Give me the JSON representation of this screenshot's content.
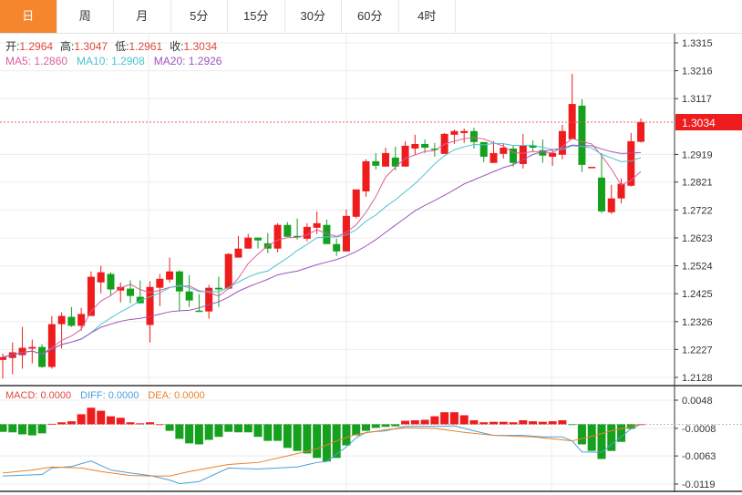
{
  "tabs": [
    {
      "label": "日",
      "active": true
    },
    {
      "label": "周"
    },
    {
      "label": "月"
    },
    {
      "label": "5分"
    },
    {
      "label": "15分"
    },
    {
      "label": "30分"
    },
    {
      "label": "60分"
    },
    {
      "label": "4时"
    }
  ],
  "info": {
    "open_label": "开:",
    "open": "1.2964",
    "high_label": "高:",
    "high": "1.3047",
    "low_label": "低:",
    "low": "1.2961",
    "close_label": "收:",
    "close": "1.3034",
    "ma5": "MA5: 1.2860",
    "ma10": "MA10: 1.2908",
    "ma20": "MA20: 1.2926"
  },
  "macd_info": {
    "macd": "MACD: 0.0000",
    "diff": "DIFF: 0.0000",
    "dea": "DEA: 0.0000"
  },
  "current_price": "1.3034",
  "colors": {
    "up": "#ee1c1c",
    "down": "#15a01e",
    "ma5": "#d9609a",
    "ma10": "#4cc3d0",
    "ma20": "#9b55bb",
    "diff": "#4b9fd8",
    "dea": "#e8822a",
    "tab_active": "#f5862e"
  },
  "chart_data": [
    {
      "type": "candlestick",
      "yticks": [
        "1.3315",
        "1.3216",
        "1.3117",
        "1.2919",
        "1.2821",
        "1.2722",
        "1.2623",
        "1.2524",
        "1.2425",
        "1.2326",
        "1.2227",
        "1.2128"
      ],
      "ylim": [
        1.2128,
        1.3315
      ],
      "grid": true,
      "ma_periods": [
        5,
        10,
        20
      ],
      "ohlc": [
        [
          1.219,
          1.2213,
          1.2124,
          1.22
        ],
        [
          1.2197,
          1.2252,
          1.2139,
          1.2217
        ],
        [
          1.2207,
          1.2307,
          1.2159,
          1.2233
        ],
        [
          1.223,
          1.2262,
          1.2178,
          1.2236
        ],
        [
          1.2236,
          1.2246,
          1.2162,
          1.2165
        ],
        [
          1.2165,
          1.2346,
          1.2159,
          1.2317
        ],
        [
          1.2317,
          1.2359,
          1.223,
          1.2346
        ],
        [
          1.2343,
          1.2378,
          1.2307,
          1.2311
        ],
        [
          1.2311,
          1.2375,
          1.2294,
          1.2353
        ],
        [
          1.2346,
          1.2504,
          1.2346,
          1.2485
        ],
        [
          1.2465,
          1.2524,
          1.2427,
          1.2501
        ],
        [
          1.2495,
          1.2501,
          1.242,
          1.244
        ],
        [
          1.2436,
          1.2465,
          1.2394,
          1.2449
        ],
        [
          1.2443,
          1.2472,
          1.2391,
          1.2417
        ],
        [
          1.2414,
          1.2472,
          1.2391,
          1.2391
        ],
        [
          1.2314,
          1.2469,
          1.2252,
          1.2449
        ],
        [
          1.2446,
          1.2495,
          1.2381,
          1.2478
        ],
        [
          1.2475,
          1.2553,
          1.2465,
          1.2504
        ],
        [
          1.2504,
          1.2508,
          1.2362,
          1.2433
        ],
        [
          1.2433,
          1.2491,
          1.2378,
          1.2401
        ],
        [
          1.2365,
          1.2423,
          1.2362,
          1.2362
        ],
        [
          1.2362,
          1.2456,
          1.2336,
          1.2446
        ],
        [
          1.2446,
          1.2485,
          1.2378,
          1.244
        ],
        [
          1.2443,
          1.2569,
          1.244,
          1.2566
        ],
        [
          1.2553,
          1.263,
          1.2553,
          1.2585
        ],
        [
          1.2585,
          1.2637,
          1.2585,
          1.2624
        ],
        [
          1.2624,
          1.2624,
          1.2585,
          1.2614
        ],
        [
          1.2604,
          1.264,
          1.2569,
          1.2585
        ],
        [
          1.2585,
          1.2675,
          1.2572,
          1.2669
        ],
        [
          1.2669,
          1.2679,
          1.2627,
          1.2627
        ],
        [
          1.263,
          1.2692,
          1.2617,
          1.2627
        ],
        [
          1.262,
          1.2675,
          1.2611,
          1.2662
        ],
        [
          1.2659,
          1.2717,
          1.2637,
          1.2675
        ],
        [
          1.2669,
          1.2688,
          1.2601,
          1.2601
        ],
        [
          1.2601,
          1.262,
          1.2559,
          1.2575
        ],
        [
          1.2575,
          1.2724,
          1.2575,
          1.2701
        ],
        [
          1.2698,
          1.2795,
          1.2692,
          1.2795
        ],
        [
          1.2788,
          1.2902,
          1.2769,
          1.2895
        ],
        [
          1.2895,
          1.2924,
          1.2866,
          1.2879
        ],
        [
          1.2876,
          1.2943,
          1.2876,
          1.2924
        ],
        [
          1.2908,
          1.2947,
          1.2863,
          1.2876
        ],
        [
          1.2876,
          1.2966,
          1.2876,
          1.295
        ],
        [
          1.294,
          1.2989,
          1.2918,
          1.2956
        ],
        [
          1.2956,
          1.2972,
          1.2924,
          1.2943
        ],
        [
          1.294,
          1.296,
          1.2911,
          1.2937
        ],
        [
          1.2921,
          1.2995,
          1.2921,
          1.2992
        ],
        [
          1.2989,
          1.3008,
          1.2956,
          1.3002
        ],
        [
          1.2995,
          1.3011,
          1.296,
          1.3002
        ],
        [
          1.3002,
          1.3014,
          1.294,
          1.2963
        ],
        [
          1.2963,
          1.2963,
          1.2892,
          1.2911
        ],
        [
          1.2889,
          1.2966,
          1.2889,
          1.2924
        ],
        [
          1.2921,
          1.296,
          1.2905,
          1.2943
        ],
        [
          1.294,
          1.295,
          1.2876,
          1.2889
        ],
        [
          1.2885,
          1.2992,
          1.2869,
          1.295
        ],
        [
          1.295,
          1.2969,
          1.2927,
          1.2943
        ],
        [
          1.2934,
          1.2972,
          1.2889,
          1.2915
        ],
        [
          1.2911,
          1.2934,
          1.2879,
          1.2924
        ],
        [
          1.2918,
          1.3024,
          1.2902,
          1.3002
        ],
        [
          1.2973,
          1.3205,
          1.2973,
          1.3098
        ],
        [
          1.3092,
          1.3115,
          1.2856,
          1.2882
        ],
        [
          1.2872,
          1.2875,
          1.2872,
          1.2875
        ],
        [
          1.2837,
          1.2924,
          1.2711,
          1.2717
        ],
        [
          1.2714,
          1.2811,
          1.2708,
          1.2763
        ],
        [
          1.2763,
          1.2834,
          1.2746,
          1.2815
        ],
        [
          1.2808,
          1.2995,
          1.2805,
          1.2966
        ],
        [
          1.2964,
          1.3047,
          1.2961,
          1.3034
        ]
      ]
    },
    {
      "type": "bar+line",
      "yticks": [
        "0.0048",
        "-0.0008",
        "-0.0063",
        "-0.0119"
      ],
      "ylim": [
        -0.0119,
        0.0048
      ],
      "macd": [
        -0.0015,
        -0.0016,
        -0.002,
        -0.0022,
        -0.0018,
        0.0001,
        0.0004,
        0.0006,
        0.002,
        0.0033,
        0.0027,
        0.0016,
        0.0013,
        0.0004,
        0.0002,
        0.0004,
        0.0,
        -0.0013,
        -0.0029,
        -0.0038,
        -0.004,
        -0.0031,
        -0.0025,
        -0.0015,
        -0.0016,
        -0.0016,
        -0.0025,
        -0.0033,
        -0.0033,
        -0.0047,
        -0.0053,
        -0.0058,
        -0.0067,
        -0.0074,
        -0.0067,
        -0.0042,
        -0.0022,
        -0.0013,
        -0.0007,
        -0.0005,
        -0.0004,
        0.0007,
        0.0008,
        0.0009,
        0.0016,
        0.0024,
        0.0024,
        0.0018,
        0.0008,
        0.0004,
        0.0005,
        0.0005,
        0.0004,
        0.0008,
        0.0006,
        0.0005,
        0.0006,
        0.0008,
        -0.0001,
        -0.004,
        -0.0053,
        -0.0069,
        -0.0053,
        -0.0035,
        -0.0009,
        0.0
      ],
      "diff": [
        [
          0,
          -0.0103
        ],
        [
          4,
          -0.01
        ],
        [
          5,
          -0.0087
        ],
        [
          7,
          -0.0084
        ],
        [
          9,
          -0.0073
        ],
        [
          11,
          -0.0091
        ],
        [
          13,
          -0.0097
        ],
        [
          15,
          -0.0102
        ],
        [
          17,
          -0.0111
        ],
        [
          18,
          -0.0118
        ],
        [
          20,
          -0.0114
        ],
        [
          23,
          -0.0087
        ],
        [
          26,
          -0.0089
        ],
        [
          28,
          -0.0087
        ],
        [
          30,
          -0.0085
        ],
        [
          32,
          -0.0076
        ],
        [
          33,
          -0.0074
        ],
        [
          35,
          -0.0045
        ],
        [
          36,
          -0.0027
        ],
        [
          37,
          -0.0016
        ],
        [
          39,
          -0.0013
        ],
        [
          41,
          -0.0004
        ],
        [
          45,
          -0.0004
        ],
        [
          46,
          -0.0003
        ],
        [
          48,
          -0.0013
        ],
        [
          50,
          -0.0022
        ],
        [
          53,
          -0.0022
        ],
        [
          55,
          -0.0025
        ],
        [
          57,
          -0.0025
        ],
        [
          58,
          -0.0033
        ],
        [
          59,
          -0.0055
        ],
        [
          61,
          -0.0056
        ],
        [
          62,
          -0.004
        ],
        [
          64,
          -0.0009
        ],
        [
          65,
          0.0
        ]
      ],
      "dea": [
        [
          0,
          -0.0097
        ],
        [
          3,
          -0.0091
        ],
        [
          5,
          -0.0085
        ],
        [
          8,
          -0.0087
        ],
        [
          10,
          -0.0094
        ],
        [
          13,
          -0.0102
        ],
        [
          15,
          -0.0103
        ],
        [
          17,
          -0.0103
        ],
        [
          19,
          -0.0094
        ],
        [
          21,
          -0.0087
        ],
        [
          23,
          -0.008
        ],
        [
          26,
          -0.0076
        ],
        [
          29,
          -0.0063
        ],
        [
          32,
          -0.0049
        ],
        [
          34,
          -0.0033
        ],
        [
          36,
          -0.002
        ],
        [
          39,
          -0.0011
        ],
        [
          41,
          -0.0007
        ],
        [
          44,
          -0.0008
        ],
        [
          47,
          -0.0016
        ],
        [
          50,
          -0.0022
        ],
        [
          54,
          -0.0025
        ],
        [
          57,
          -0.0031
        ],
        [
          58,
          -0.0033
        ],
        [
          60,
          -0.0024
        ],
        [
          62,
          -0.0013
        ],
        [
          65,
          0.0
        ]
      ]
    }
  ]
}
